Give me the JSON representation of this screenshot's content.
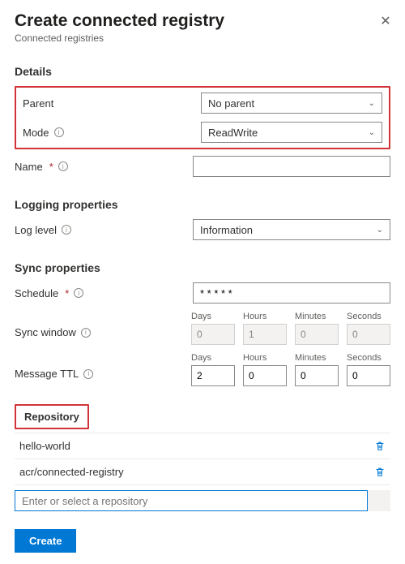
{
  "header": {
    "title": "Create connected registry",
    "subtitle": "Connected registries"
  },
  "sections": {
    "details": "Details",
    "logging": "Logging properties",
    "sync": "Sync properties"
  },
  "labels": {
    "parent": "Parent",
    "mode": "Mode",
    "name": "Name",
    "log_level": "Log level",
    "schedule": "Schedule",
    "sync_window": "Sync window",
    "message_ttl": "Message TTL",
    "repository_tab": "Repository",
    "days": "Days",
    "hours": "Hours",
    "minutes": "Minutes",
    "seconds": "Seconds"
  },
  "values": {
    "parent": "No parent",
    "mode": "ReadWrite",
    "name": "",
    "log_level": "Information",
    "schedule": "* * * * *",
    "sync_window": {
      "days": "0",
      "hours": "1",
      "minutes": "0",
      "seconds": "0"
    },
    "message_ttl": {
      "days": "2",
      "hours": "0",
      "minutes": "0",
      "seconds": "0"
    }
  },
  "repositories": [
    "hello-world",
    "acr/connected-registry"
  ],
  "placeholders": {
    "repo_search": "Enter or select a repository"
  },
  "buttons": {
    "create": "Create"
  }
}
